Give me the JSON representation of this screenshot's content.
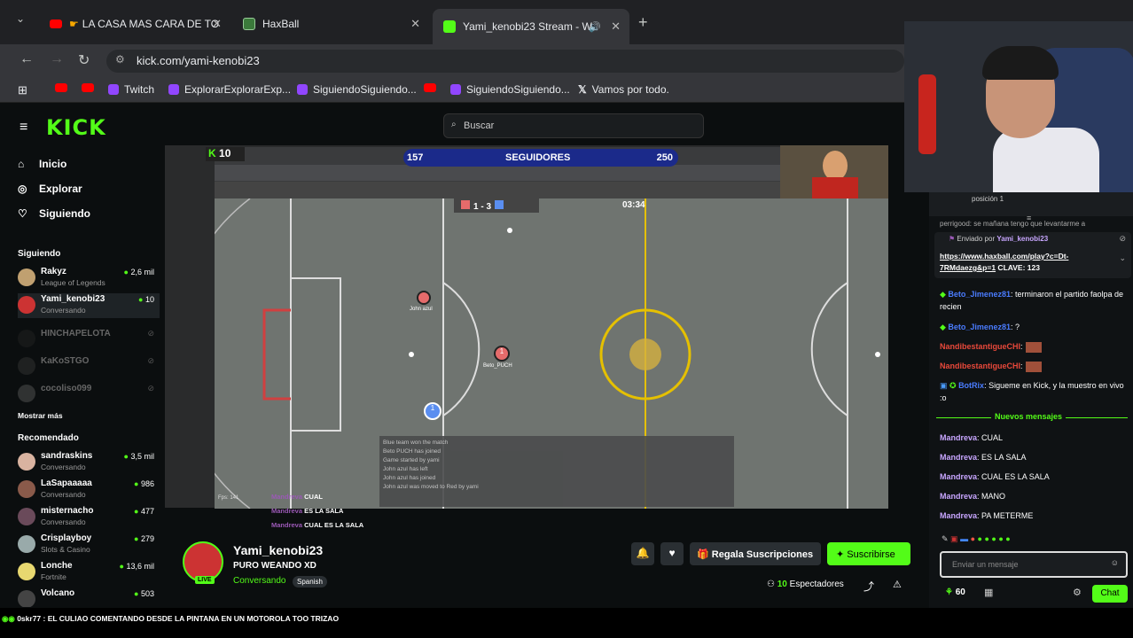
{
  "browser": {
    "tabs": [
      {
        "label": "LA CASA MAS CARA DE TO",
        "color": "#ff0000"
      },
      {
        "label": "HaxBall",
        "color": "#3b7a3b"
      },
      {
        "label": "Yami_kenobi23 Stream - W",
        "color": "#53fc18"
      }
    ],
    "url": "kick.com/yami-kenobi23",
    "bookmarks": [
      "Twitch",
      "ExplorarExplorarExp...",
      "SiguiendoSiguiendo...",
      "SiguiendoSiguiendo...",
      "Vamos por todo."
    ]
  },
  "kick": {
    "search_placeholder": "Buscar",
    "nav": [
      "Inicio",
      "Explorar",
      "Siguiendo"
    ],
    "following_title": "Siguiendo",
    "following": [
      {
        "name": "Rakyz",
        "sub": "League of Legends",
        "viewers": "2,6 mil",
        "live": true
      },
      {
        "name": "Yami_kenobi23",
        "sub": "Conversando",
        "viewers": "10",
        "live": true
      },
      {
        "name": "HINCHAPELOTA",
        "sub": "",
        "viewers": "",
        "live": false
      },
      {
        "name": "KaKoSTGO",
        "sub": "",
        "viewers": "",
        "live": false
      },
      {
        "name": "cocoliso099",
        "sub": "",
        "viewers": "",
        "live": false
      }
    ],
    "show_more": "Mostrar más",
    "recommended_title": "Recomendado",
    "recommended": [
      {
        "name": "sandraskins",
        "sub": "Conversando",
        "viewers": "3,5 mil"
      },
      {
        "name": "LaSapaaaaa",
        "sub": "Conversando",
        "viewers": "986"
      },
      {
        "name": "misternacho",
        "sub": "Conversando",
        "viewers": "477"
      },
      {
        "name": "Crisplayboy",
        "sub": "Slots & Casino",
        "viewers": "279"
      },
      {
        "name": "Lonche",
        "sub": "Fortnite",
        "viewers": "13,6 mil"
      },
      {
        "name": "Volcano",
        "sub": "",
        "viewers": "503"
      }
    ]
  },
  "stream": {
    "overlay": {
      "count_left": "157",
      "label": "SEGUIDORES",
      "count_right": "250",
      "kick_count": "10"
    },
    "game": {
      "score": "1 - 3",
      "time": "03:34",
      "fps": "Fps: 141",
      "players": [
        "John azul",
        "Beto_PUCH"
      ],
      "log": [
        "Blue team won the match",
        "Beto PUCH has joined",
        "Game started by yami",
        "John azul has left",
        "John azul has joined",
        "John azul was moved to Red by yami"
      ],
      "chat_overlay": [
        {
          "u": "Mandreva",
          "t": "CUAL"
        },
        {
          "u": "Mandreva",
          "t": "ES LA SALA"
        },
        {
          "u": "Mandreva",
          "t": "CUAL ES LA SALA"
        }
      ]
    },
    "streamer": "Yami_kenobi23",
    "title": "PURO WEANDO XD",
    "category": "Conversando",
    "language": "Spanish",
    "live_badge": "LIVE",
    "gift_label": "Regala Suscripciones",
    "subscribe_label": "Suscribirse",
    "viewers_count": "10",
    "viewers_label": "Espectadores"
  },
  "chat": {
    "pinned_position": "posición 1",
    "pinned_top": "perrigood: se mañana tengo que levantarme a",
    "sent_by": "Enviado por",
    "sent_by_user": "Yami_kenobi23",
    "pinned_link": "https://www.haxball.com/play?c=Dt-7RMdaezg&p=1",
    "pinned_key": " CLAVE: 123",
    "messages": [
      {
        "u": "Beto_Jimenez81",
        "t": ": terminaron el partido faolpa de recien",
        "c": "#4a7cff"
      },
      {
        "u": "Beto_Jimenez81",
        "t": ": ?",
        "c": "#4a7cff"
      },
      {
        "u": "NandibestantigueCHI",
        "t": ":",
        "c": "#e8483a"
      },
      {
        "u": "NandibestantigueCHI",
        "t": ":",
        "c": "#e8483a"
      },
      {
        "u": "BotRix",
        "t": ": Sigueme en Kick, y la muestro en vivo :o",
        "c": "#4a7cff"
      }
    ],
    "new_messages": "Nuevos mensajes",
    "new": [
      {
        "u": "Mandreva",
        "t": ": CUAL"
      },
      {
        "u": "Mandreva",
        "t": ": ES LA SALA"
      },
      {
        "u": "Mandreva",
        "t": ": CUAL ES LA SALA"
      },
      {
        "u": "Mandreva",
        "t": ": MANO"
      },
      {
        "u": "Mandreva",
        "t": ": PA METERME"
      }
    ],
    "input_placeholder": "Enviar un mensaje",
    "points": "60",
    "send_label": "Chat"
  },
  "ticker": {
    "user": "0skr77",
    "text": " : EL CULIAO COMENTANDO DESDE LA PINTANA EN UN MOTOROLA TOO TRIZAO"
  }
}
